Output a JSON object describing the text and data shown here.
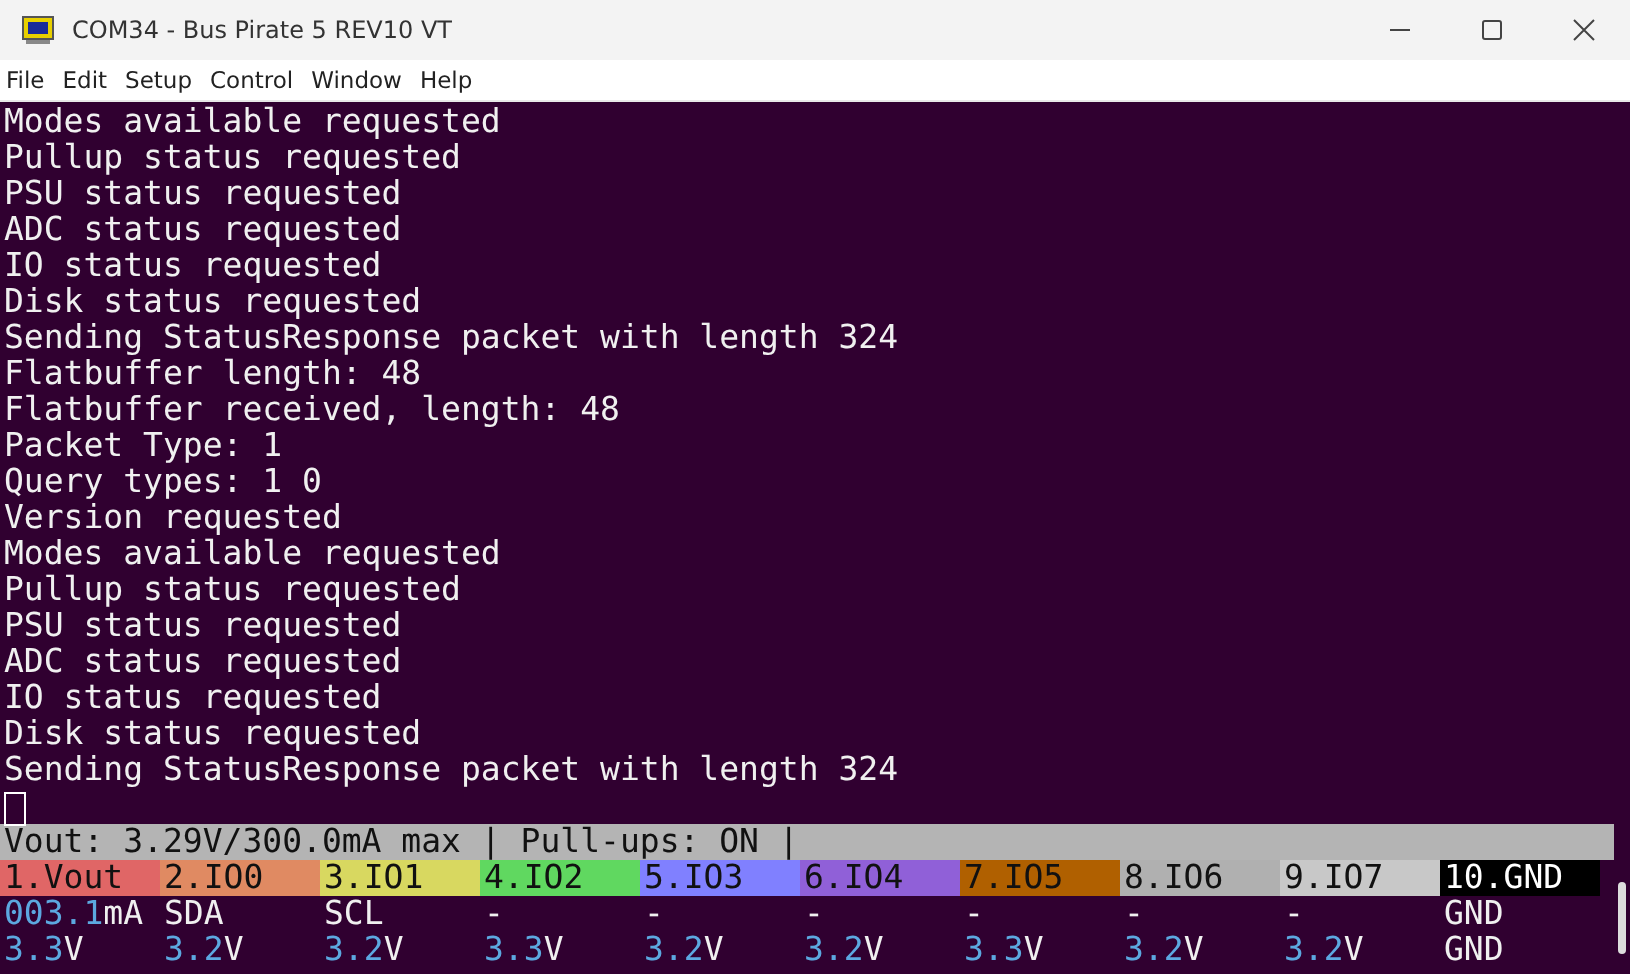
{
  "window": {
    "title": "COM34 - Bus Pirate 5 REV10 VT"
  },
  "menu": [
    "File",
    "Edit",
    "Setup",
    "Control",
    "Window",
    "Help"
  ],
  "terminal": {
    "lines": [
      "Modes available requested",
      "Pullup status requested",
      "PSU status requested",
      "ADC status requested",
      "IO status requested",
      "Disk status requested",
      "Sending StatusResponse packet with length 324",
      "Flatbuffer length: 48",
      "Flatbuffer received, length: 48",
      "Packet Type: 1",
      "Query types: 1 0",
      "Version requested",
      "Modes available requested",
      "Pullup status requested",
      "PSU status requested",
      "ADC status requested",
      "IO status requested",
      "Disk status requested",
      "Sending StatusResponse packet with length 324"
    ],
    "status_line": "Vout: 3.29V/300.0mA max | Pull-ups: ON |",
    "pins": [
      {
        "label": "1.Vout",
        "color": "#e06666",
        "reading": "003.1",
        "reading_unit": "mA",
        "volts": "3.3",
        "unit": "V"
      },
      {
        "label": "2.IO0",
        "color": "#e08a62",
        "function": "SDA",
        "volts": "3.2",
        "unit": "V"
      },
      {
        "label": "3.IO1",
        "color": "#d8d860",
        "function": "SCL",
        "volts": "3.2",
        "unit": "V"
      },
      {
        "label": "4.IO2",
        "color": "#60d860",
        "function": "-",
        "volts": "3.3",
        "unit": "V"
      },
      {
        "label": "5.IO3",
        "color": "#8080ff",
        "function": "-",
        "volts": "3.2",
        "unit": "V"
      },
      {
        "label": "6.IO4",
        "color": "#9060d8",
        "function": "-",
        "volts": "3.2",
        "unit": "V"
      },
      {
        "label": "7.IO5",
        "color": "#b06000",
        "function": "-",
        "volts": "3.3",
        "unit": "V"
      },
      {
        "label": "8.IO6",
        "color": "#b0b0b0",
        "function": "-",
        "volts": "3.2",
        "unit": "V"
      },
      {
        "label": "9.IO7",
        "color": "#c8c8c8",
        "function": "-",
        "volts": "3.2",
        "unit": "V"
      },
      {
        "label": "10.GND",
        "color": "#000000",
        "function": "GND",
        "unit": "GND"
      }
    ]
  }
}
